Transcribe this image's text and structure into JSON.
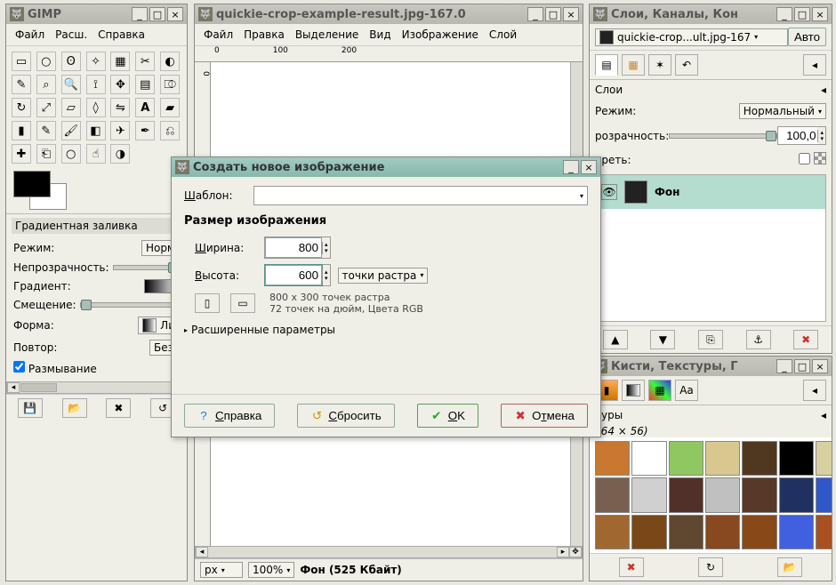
{
  "toolbox": {
    "title": "GIMP",
    "menu": [
      "Файл",
      "Расш.",
      "Справка"
    ],
    "options_title": "Градиентная заливка",
    "mode_label": "Режим:",
    "mode_value": "Норм",
    "opacity_label": "Непрозрачность:",
    "gradient_label": "Градиент:",
    "offset_label": "Смещение:",
    "shape_label": "Форма:",
    "shape_value": "Ли",
    "repeat_label": "Повтор:",
    "repeat_value": "Без",
    "blur_label": "Размывание"
  },
  "imagewin": {
    "title": "quickie-crop-example-result.jpg-167.0",
    "menu": [
      "Файл",
      "Правка",
      "Выделение",
      "Вид",
      "Изображение",
      "Слой"
    ],
    "ruler_marks": [
      "0",
      "100",
      "200"
    ],
    "unit": "px",
    "zoom": "100%",
    "status": "Фон (525 Кбайт)"
  },
  "layerswin": {
    "title": "Слои, Каналы, Кон",
    "image_selector": "quickie-crop...ult.jpg-167",
    "auto": "Авто",
    "section": "Слои",
    "mode_label": "Режим:",
    "mode_value": "Нормальный",
    "opacity_label": "розрачность:",
    "opacity_value": "100,0",
    "lock_label": "ереть:",
    "layer_name": "Фон"
  },
  "brusheswin": {
    "title": "Кисти, Текстуры, Г",
    "section": "туры",
    "size": "(64 × 56)",
    "textures": [
      "#c87830",
      "#ffffff",
      "#8fc860",
      "#d8c890",
      "#503820",
      "#000000",
      "#d8d0a0",
      "#786050",
      "#d0d0d0",
      "#503028",
      "#c0c0c0",
      "#583828",
      "#203060",
      "#3058c8",
      "#a06830",
      "#784818",
      "#604830",
      "#884820",
      "#884818",
      "#4060e0",
      "#a85020",
      "#b06830",
      "#884818",
      "#884818",
      "#884818",
      "#884818",
      "#884818",
      "#884818"
    ]
  },
  "dialog": {
    "title": "Создать новое изображение",
    "template_label": "Шаблон:",
    "size_section": "Размер изображения",
    "width_label": "Ширина:",
    "width_value": "800",
    "height_label": "Высота:",
    "height_value": "600",
    "unit_value": "точки растра",
    "info1": "800 x 300 точек растра",
    "info2": "72 точек на дюйм, Цвета RGB",
    "advanced": "Расширенные параметры",
    "help": "Справка",
    "reset": "Сбросить",
    "ok": "OK",
    "cancel": "Отмена"
  }
}
